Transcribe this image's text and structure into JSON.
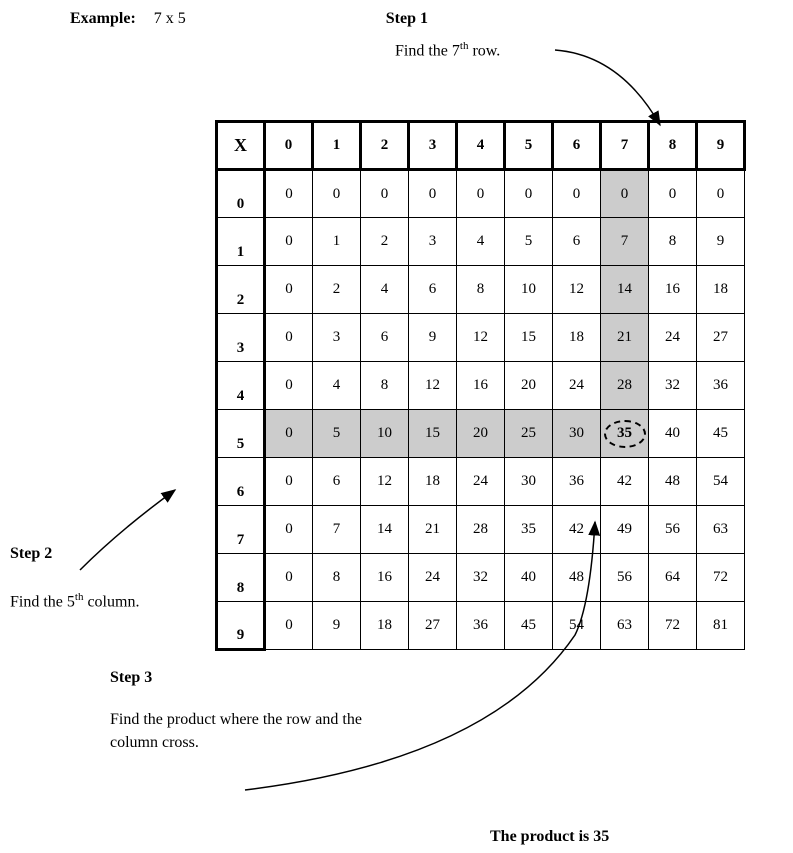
{
  "example": {
    "label": "Example:",
    "text": "7 x 5"
  },
  "step1": {
    "label": "Step 1",
    "text_before": "Find the 7",
    "sup": "th",
    "text_after": " row."
  },
  "step2": {
    "label": "Step 2",
    "text_before": "Find the 5",
    "sup": "th",
    "text_after": " column."
  },
  "step3": {
    "label": "Step 3",
    "text": "Find the product where the row and the column cross."
  },
  "product": "The product is 35",
  "table": {
    "corner": "X",
    "col_headers": [
      "0",
      "1",
      "2",
      "3",
      "4",
      "5",
      "6",
      "7",
      "8",
      "9"
    ],
    "row_headers": [
      "0",
      "1",
      "2",
      "3",
      "4",
      "5",
      "6",
      "7",
      "8",
      "9"
    ],
    "rows": [
      [
        "0",
        "0",
        "0",
        "0",
        "0",
        "0",
        "0",
        "0",
        "0",
        "0"
      ],
      [
        "0",
        "1",
        "2",
        "3",
        "4",
        "5",
        "6",
        "7",
        "8",
        "9"
      ],
      [
        "0",
        "2",
        "4",
        "6",
        "8",
        "10",
        "12",
        "14",
        "16",
        "18"
      ],
      [
        "0",
        "3",
        "6",
        "9",
        "12",
        "15",
        "18",
        "21",
        "24",
        "27"
      ],
      [
        "0",
        "4",
        "8",
        "12",
        "16",
        "20",
        "24",
        "28",
        "32",
        "36"
      ],
      [
        "0",
        "5",
        "10",
        "15",
        "20",
        "25",
        "30",
        "35",
        "40",
        "45"
      ],
      [
        "0",
        "6",
        "12",
        "18",
        "24",
        "30",
        "36",
        "42",
        "48",
        "54"
      ],
      [
        "0",
        "7",
        "14",
        "21",
        "28",
        "35",
        "42",
        "49",
        "56",
        "63"
      ],
      [
        "0",
        "8",
        "16",
        "24",
        "32",
        "40",
        "48",
        "56",
        "64",
        "72"
      ],
      [
        "0",
        "9",
        "18",
        "27",
        "36",
        "45",
        "54",
        "63",
        "72",
        "81"
      ]
    ],
    "highlight_row": 5,
    "highlight_col": 7
  }
}
